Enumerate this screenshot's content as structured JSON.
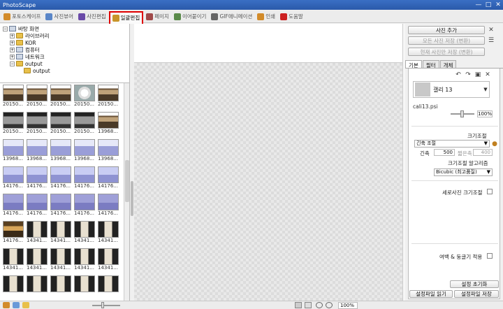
{
  "window": {
    "title": "PhotoScape",
    "minimize": "—",
    "maximize": "□",
    "close": "✕"
  },
  "tabs": [
    {
      "label": "포토스케이프",
      "color": "#d28b2a"
    },
    {
      "label": "사진뷰어",
      "color": "#5a86c8"
    },
    {
      "label": "사진편집",
      "color": "#6a4aa8"
    },
    {
      "label": "일괄편집",
      "color": "#c8952a"
    },
    {
      "label": "페이지",
      "color": "#a04a4a"
    },
    {
      "label": "이어붙이기",
      "color": "#5a8a4a"
    },
    {
      "label": "GIF애니메이션",
      "color": "#666666"
    },
    {
      "label": "인쇄",
      "color": "#d28b2a"
    },
    {
      "label": "도움말",
      "color": "#cc2020"
    }
  ],
  "tree": {
    "root": "바탕 화면",
    "items": [
      "라이브러리",
      "KOR",
      "컴퓨터",
      "네트워크",
      "output"
    ],
    "child": "output"
  },
  "thumbnails": [
    {
      "label": "20150...",
      "kind": "boat"
    },
    {
      "label": "20150...",
      "kind": "boat"
    },
    {
      "label": "20150...",
      "kind": "boat"
    },
    {
      "label": "20150...",
      "kind": "cake"
    },
    {
      "label": "20150...",
      "kind": "boat"
    },
    {
      "label": "20150...",
      "kind": "dark"
    },
    {
      "label": "20150...",
      "kind": "dark"
    },
    {
      "label": "20150...",
      "kind": "dark"
    },
    {
      "label": "20150...",
      "kind": "dark"
    },
    {
      "label": "13968...",
      "kind": "boat"
    },
    {
      "label": "13968...",
      "kind": "sea"
    },
    {
      "label": "13968...",
      "kind": "sea"
    },
    {
      "label": "13968...",
      "kind": "sea"
    },
    {
      "label": "13968...",
      "kind": "sea"
    },
    {
      "label": "13968...",
      "kind": "sea"
    },
    {
      "label": "14176...",
      "kind": "sky"
    },
    {
      "label": "14176...",
      "kind": "sky"
    },
    {
      "label": "14176...",
      "kind": "sky"
    },
    {
      "label": "14176...",
      "kind": "sky"
    },
    {
      "label": "14176...",
      "kind": "sky"
    },
    {
      "label": "14176...",
      "kind": "dusk"
    },
    {
      "label": "14176...",
      "kind": "dusk"
    },
    {
      "label": "14176...",
      "kind": "dusk"
    },
    {
      "label": "14176...",
      "kind": "dusk"
    },
    {
      "label": "14176...",
      "kind": "dusk"
    },
    {
      "label": "14176...",
      "kind": "sunset"
    },
    {
      "label": "14341...",
      "kind": "door"
    },
    {
      "label": "14341...",
      "kind": "door"
    },
    {
      "label": "14341...",
      "kind": "door"
    },
    {
      "label": "14341...",
      "kind": "door"
    },
    {
      "label": "14341...",
      "kind": "door"
    },
    {
      "label": "14341...",
      "kind": "door"
    },
    {
      "label": "14341...",
      "kind": "door"
    },
    {
      "label": "14341...",
      "kind": "door"
    },
    {
      "label": "14341...",
      "kind": "door"
    },
    {
      "label": "",
      "kind": "door"
    },
    {
      "label": "",
      "kind": "door"
    },
    {
      "label": "",
      "kind": "door"
    },
    {
      "label": "",
      "kind": "door"
    },
    {
      "label": "",
      "kind": "door"
    }
  ],
  "right": {
    "add_photo": "사진 추가",
    "save_all": "모든 사진 저장 (변환)",
    "save_current": "현재 사진만 저장 (변환)",
    "subtabs": [
      "기본",
      "필터",
      "개체"
    ],
    "frame_name": "갤리 13",
    "frame_file": "cali13.psi",
    "frame_pct": "100%",
    "resize_label": "크기조절",
    "resize_mode": "긴축 조절",
    "long_side_label": "긴축",
    "long_side_value": "500",
    "short_side_label": "짧은축",
    "short_side_value": "400",
    "algo_label": "크기조절 알고리즘",
    "algo_value": "Bicubic (최고품질)",
    "portrait_label": "세로사진 크기조절",
    "margin_label": "여백 & 둥글기 적용",
    "reset_btn": "설정 초기화",
    "load_btn": "설정파일 읽기",
    "save_btn": "설정파일 저장"
  },
  "status": {
    "zoom": "100%"
  }
}
